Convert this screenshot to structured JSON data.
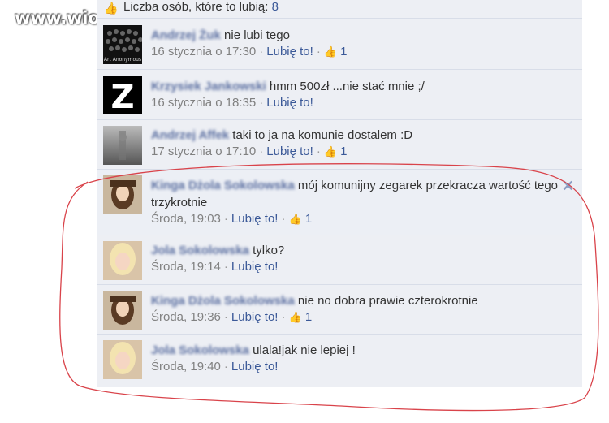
{
  "watermark": "www.wiocha.pl",
  "likes_row": {
    "label": "Liczba osób, które to lubią:",
    "count": "8"
  },
  "comments": [
    {
      "name": "Andrzej Żuk",
      "text": "nie lubi tego",
      "date": "16 stycznia o 17:30",
      "like_label": "Lubię to!",
      "likes": "1",
      "avatar": "Art Anonymous"
    },
    {
      "name": "Krzysiek Jankowski",
      "text": "hmm 500zł ...nie stać mnie ;/",
      "date": "16 stycznia o 18:35",
      "like_label": "Lubię to!",
      "likes": null,
      "avatar": "Z"
    },
    {
      "name": "Andrzej Affek",
      "text": "taki to ja na komunie dostalem :D",
      "date": "17 stycznia o 17:10",
      "like_label": "Lubię to!",
      "likes": "1"
    },
    {
      "name": "Kinga Dżola Sokolowska",
      "text": "mój komunijny zegarek przekracza wartość tego trzykrotnie",
      "date": "Środa, 19:03",
      "like_label": "Lubię to!",
      "likes": "1"
    },
    {
      "name": "Jola Sokolowska",
      "text": "tylko?",
      "date": "Środa, 19:14",
      "like_label": "Lubię to!",
      "likes": null
    },
    {
      "name": "Kinga Dżola Sokolowska",
      "text": "nie no dobra prawie czterokrotnie",
      "date": "Środa, 19:36",
      "like_label": "Lubię to!",
      "likes": "1"
    },
    {
      "name": "Jola Sokolowska",
      "text": "ulala!jak nie lepiej !",
      "date": "Środa, 19:40",
      "like_label": "Lubię to!",
      "likes": null
    }
  ],
  "icons": {
    "thumb": "thumbs-up-icon",
    "close": "close-icon"
  },
  "colors": {
    "link": "#3b5998",
    "meta": "#808080",
    "panel": "#edeff4",
    "annotation": "#d9434a"
  }
}
